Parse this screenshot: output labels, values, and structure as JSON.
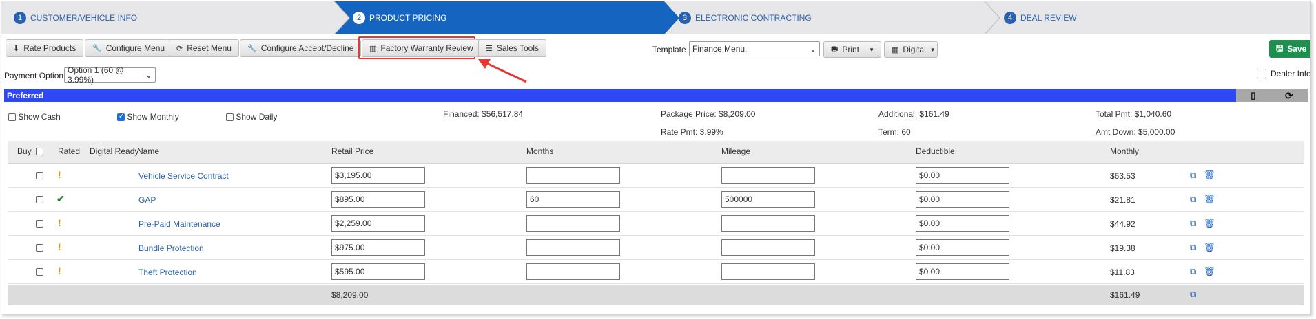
{
  "wizard": {
    "steps": [
      {
        "num": "1",
        "label": "CUSTOMER/VEHICLE INFO"
      },
      {
        "num": "2",
        "label": "PRODUCT PRICING"
      },
      {
        "num": "3",
        "label": "ELECTRONIC CONTRACTING"
      },
      {
        "num": "4",
        "label": "DEAL REVIEW"
      }
    ]
  },
  "toolbar": {
    "rate_products": "Rate Products",
    "configure_menu": "Configure Menu",
    "reset_menu": "Reset Menu",
    "configure_accept": "Configure Accept/Decline",
    "factory_warranty": "Factory Warranty Review",
    "sales_tools": "Sales Tools",
    "template_label": "Template",
    "template_value": "Finance Menu.",
    "print": "Print",
    "digital": "Digital",
    "save": "Save"
  },
  "payment": {
    "label": "Payment Option",
    "value": "Option 1 (60 @ 3.99%)"
  },
  "dealer_info": "Dealer Info",
  "section_title": "Preferred",
  "options": {
    "show_cash": "Show Cash",
    "show_monthly": "Show Monthly",
    "show_daily": "Show Daily"
  },
  "summary": {
    "financed": "Financed: $56,517.84",
    "package_price": "Package Price: $8,209.00",
    "rate_pmt": "Rate Pmt: 3.99%",
    "additional": "Additional: $161.49",
    "term": "Term: 60",
    "total_pmt": "Total Pmt: $1,040.60",
    "amt_down": "Amt Down: $5,000.00"
  },
  "table": {
    "headers": {
      "buy": "Buy",
      "rated": "Rated",
      "digital_ready": "Digital Ready",
      "name": "Name",
      "retail": "Retail Price",
      "months": "Months",
      "mileage": "Mileage",
      "deductible": "Deductible",
      "monthly": "Monthly"
    },
    "rows": [
      {
        "status": "warn",
        "name": "Vehicle Service Contract",
        "retail": "$3,195.00",
        "months": "",
        "mileage": "",
        "deductible": "$0.00",
        "monthly": "$63.53"
      },
      {
        "status": "ok",
        "name": "GAP",
        "retail": "$895.00",
        "months": "60",
        "mileage": "500000",
        "deductible": "$0.00",
        "monthly": "$21.81"
      },
      {
        "status": "warn",
        "name": "Pre-Paid Maintenance",
        "retail": "$2,259.00",
        "months": "",
        "mileage": "",
        "deductible": "$0.00",
        "monthly": "$44.92"
      },
      {
        "status": "warn",
        "name": "Bundle Protection",
        "retail": "$975.00",
        "months": "",
        "mileage": "",
        "deductible": "$0.00",
        "monthly": "$19.38"
      },
      {
        "status": "warn",
        "name": "Theft Protection",
        "retail": "$595.00",
        "months": "",
        "mileage": "",
        "deductible": "$0.00",
        "monthly": "$11.83"
      }
    ],
    "footer": {
      "retail_total": "$8,209.00",
      "monthly_total": "$161.49"
    }
  },
  "colors": {
    "accent": "#1565c0",
    "save": "#1e8f4e",
    "section_bar": "#2e48f5",
    "highlight": "#e53935"
  }
}
